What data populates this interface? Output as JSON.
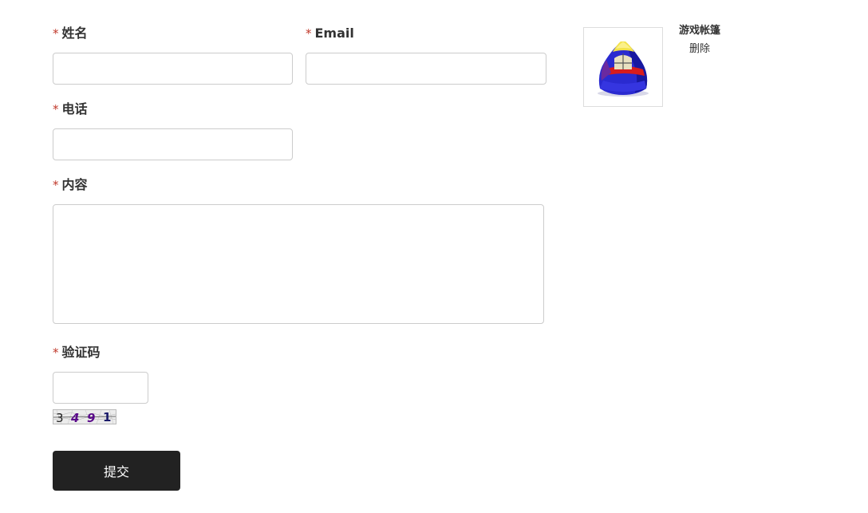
{
  "form": {
    "required_mark": "*",
    "fields": {
      "name": {
        "label": "姓名",
        "value": "",
        "placeholder": ""
      },
      "email": {
        "label": "Email",
        "value": "",
        "placeholder": ""
      },
      "phone": {
        "label": "电话",
        "value": "",
        "placeholder": ""
      },
      "content": {
        "label": "内容",
        "value": "",
        "placeholder": ""
      },
      "captcha": {
        "label": "验证码",
        "value": "",
        "placeholder": ""
      }
    },
    "captcha_code": [
      "3",
      "4",
      "9",
      "1"
    ],
    "submit_label": "提交"
  },
  "product": {
    "name": "游戏帐篷",
    "delete_label": "删除"
  },
  "colors": {
    "required": "#c0392b",
    "button_bg": "#222222",
    "button_text": "#ffffff",
    "border": "#cccccc",
    "captcha_digit_1": "#222222",
    "captcha_digit_2": "#5a0a8a",
    "captcha_digit_3": "#5a0a8a",
    "captcha_digit_4": "#1a1a6a"
  }
}
